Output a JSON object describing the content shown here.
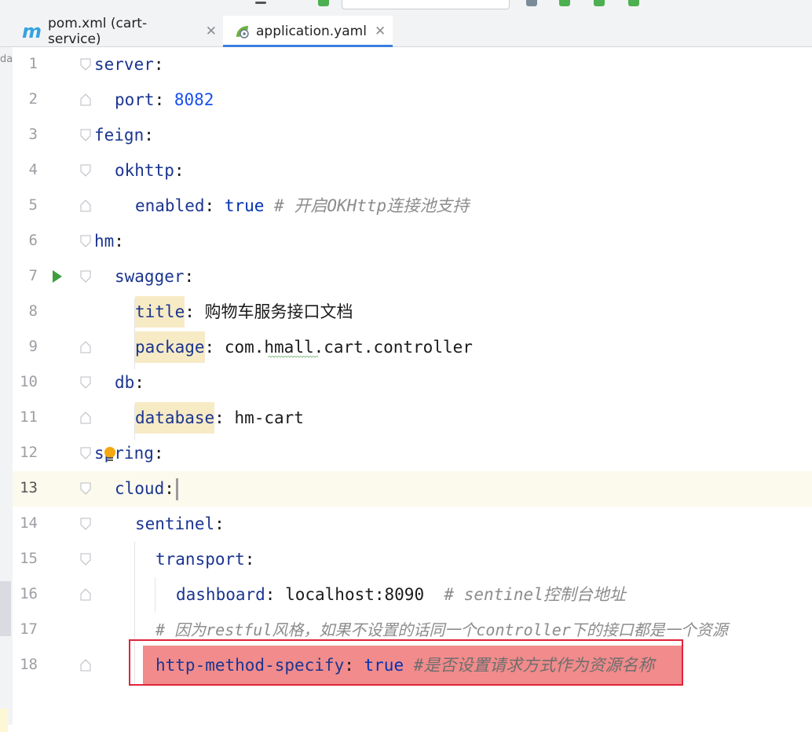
{
  "tabs": [
    {
      "label": "pom.xml (cart-service)",
      "icon": "maven-icon",
      "active": false
    },
    {
      "label": "application.yaml",
      "icon": "spring-leaf-icon",
      "active": true
    }
  ],
  "colors": {
    "accent": "#3d7ee0",
    "key": "#1b3590",
    "number": "#1750eb",
    "boolean": "#0033b3",
    "comment": "#8c8c8c",
    "highlight_red": "#f28b8b",
    "box_red": "#e0243a"
  },
  "lines": [
    {
      "num": "1",
      "key": "server",
      "value": "",
      "comment": ""
    },
    {
      "num": "2",
      "key": "port",
      "value": "8082",
      "comment": ""
    },
    {
      "num": "3",
      "key": "feign",
      "value": "",
      "comment": ""
    },
    {
      "num": "4",
      "key": "okhttp",
      "value": "",
      "comment": ""
    },
    {
      "num": "5",
      "key": "enabled",
      "value": "true",
      "comment": "# 开启OKHttp连接池支持"
    },
    {
      "num": "6",
      "key": "hm",
      "value": "",
      "comment": ""
    },
    {
      "num": "7",
      "key": "swagger",
      "value": "",
      "comment": ""
    },
    {
      "num": "8",
      "key": "title",
      "value": "购物车服务接口文档",
      "comment": ""
    },
    {
      "num": "9",
      "key": "package",
      "value": "com.hmall.cart.controller",
      "comment": ""
    },
    {
      "num": "10",
      "key": "db",
      "value": "",
      "comment": ""
    },
    {
      "num": "11",
      "key": "database",
      "value": "hm-cart",
      "comment": ""
    },
    {
      "num": "12",
      "key": "spring",
      "value": "",
      "comment": ""
    },
    {
      "num": "13",
      "key": "cloud",
      "value": "",
      "comment": ""
    },
    {
      "num": "14",
      "key": "sentinel",
      "value": "",
      "comment": ""
    },
    {
      "num": "15",
      "key": "transport",
      "value": "",
      "comment": ""
    },
    {
      "num": "16",
      "key": "dashboard",
      "value": "localhost:8090",
      "comment": "# sentinel控制台地址"
    },
    {
      "num": "17",
      "key": "",
      "value": "",
      "comment": "# 因为restful风格，如果不设置的话同一个controller下的接口都是一个资源"
    },
    {
      "num": "18",
      "key": "http-method-specify",
      "value": "true",
      "comment": "#是否设置请求方式作为资源名称"
    }
  ]
}
